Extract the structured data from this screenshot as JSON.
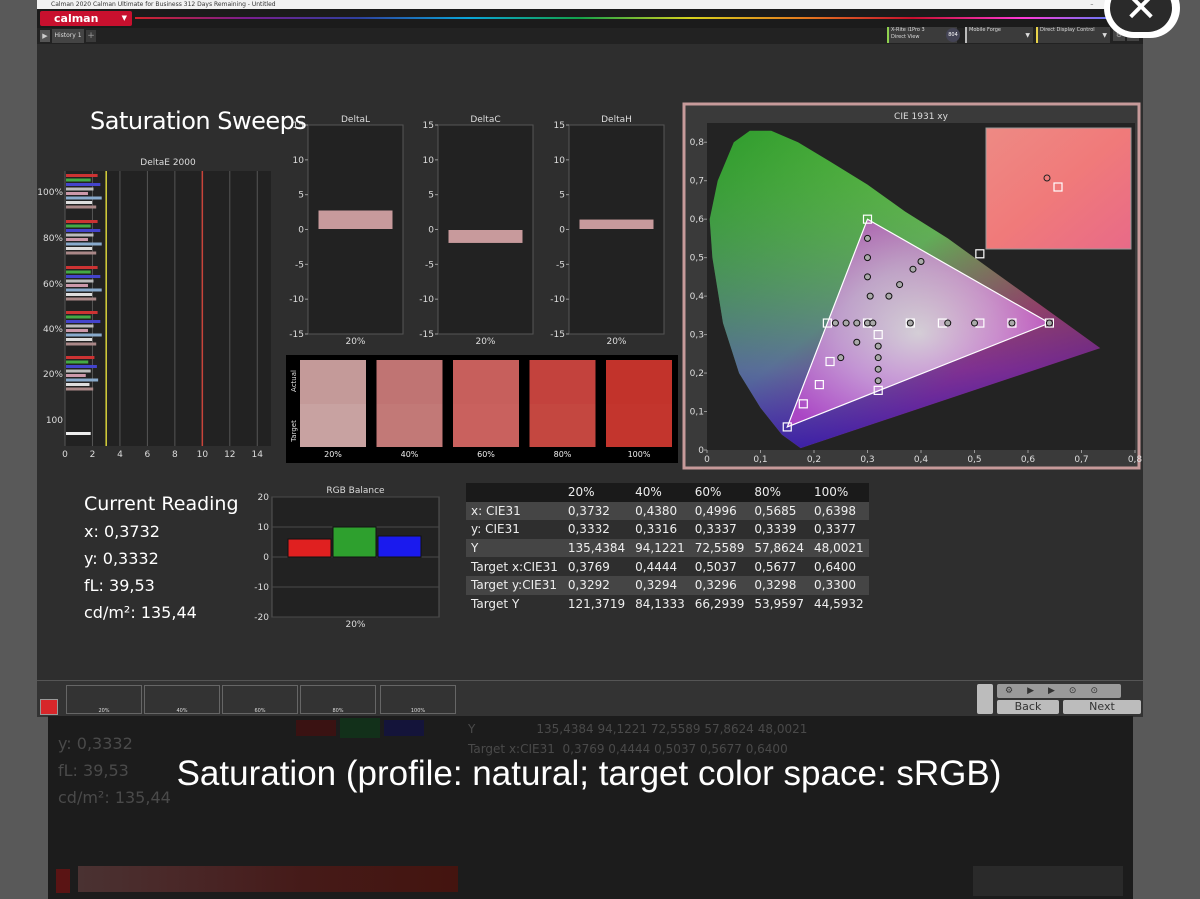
{
  "window": {
    "title": "Calman 2020 Calman Ultimate for Business 312 Days Remaining - Untitled",
    "logo": "calman",
    "history_tab": "History 1",
    "devices": [
      {
        "line1": "X-Rite i1Pro 3",
        "line2": "Direct View"
      },
      {
        "line1": "Mobile Forge",
        "line2": ""
      },
      {
        "line1": "Direct Display Control",
        "line2": ""
      }
    ],
    "badge": "804"
  },
  "page": {
    "title": "Saturation Sweeps",
    "caption": "Saturation (profile: natural; target color space: sRGB)"
  },
  "current_reading": {
    "heading": "Current Reading",
    "x": "x: 0,3732",
    "y": "y: 0,3332",
    "fl": "fL: 39,53",
    "cdm2": "cd/m²: 135,44"
  },
  "chart_data": [
    {
      "type": "bar",
      "title": "DeltaE 2000",
      "orientation": "horizontal",
      "categories": [
        "100%",
        "80%",
        "60%",
        "40%",
        "20%",
        "100"
      ],
      "xticks": [
        "0",
        "2",
        "4",
        "6",
        "8",
        "10",
        "12",
        "14"
      ],
      "xlim": [
        0,
        15
      ],
      "reference_lines": [
        3,
        10
      ]
    },
    {
      "type": "bar",
      "title": "DeltaL",
      "categories": [
        "20%"
      ],
      "values": [
        2.8
      ],
      "ylim": [
        -15,
        15
      ],
      "yticks": [
        "15",
        "10",
        "5",
        "0",
        "-5",
        "-10",
        "-15"
      ]
    },
    {
      "type": "bar",
      "title": "DeltaC",
      "categories": [
        "20%"
      ],
      "values": [
        -2.0
      ],
      "ylim": [
        -15,
        15
      ],
      "yticks": [
        "15",
        "10",
        "5",
        "0",
        "-5",
        "-10",
        "-15"
      ]
    },
    {
      "type": "bar",
      "title": "DeltaH",
      "categories": [
        "20%"
      ],
      "values": [
        1.5
      ],
      "ylim": [
        -15,
        15
      ],
      "yticks": [
        "15",
        "10",
        "5",
        "0",
        "-5",
        "-10",
        "-15"
      ]
    },
    {
      "type": "bar",
      "title": "RGB Balance",
      "categories": [
        "20%"
      ],
      "series": [
        {
          "color": "#e02020",
          "values": [
            6
          ]
        },
        {
          "color": "#2ea02e",
          "values": [
            10
          ]
        },
        {
          "color": "#1a1aee",
          "values": [
            7
          ]
        }
      ],
      "ylim": [
        -20,
        20
      ],
      "yticks": [
        "20",
        "10",
        "0",
        "-10",
        "-20"
      ]
    },
    {
      "type": "scatter",
      "title": "CIE 1931 xy",
      "xlim": [
        0,
        0.8
      ],
      "ylim": [
        0,
        0.85
      ],
      "xticks": [
        "0",
        "0,1",
        "0,2",
        "0,3",
        "0,4",
        "0,5",
        "0,6",
        "0,7",
        "0,8"
      ],
      "yticks": [
        "0",
        "0,1",
        "0,2",
        "0,3",
        "0,4",
        "0,5",
        "0,6",
        "0,7",
        "0,8"
      ],
      "gamut": [
        [
          0.64,
          0.33
        ],
        [
          0.3,
          0.6
        ],
        [
          0.15,
          0.06
        ]
      ],
      "targets": [
        [
          0.3,
          0.6
        ],
        [
          0.3,
          0.33
        ],
        [
          0.23,
          0.23
        ],
        [
          0.21,
          0.17
        ],
        [
          0.18,
          0.12
        ],
        [
          0.15,
          0.06
        ],
        [
          0.32,
          0.155
        ],
        [
          0.32,
          0.3
        ],
        [
          0.64,
          0.33
        ],
        [
          0.57,
          0.33
        ],
        [
          0.51,
          0.33
        ],
        [
          0.44,
          0.33
        ],
        [
          0.38,
          0.33
        ],
        [
          0.51,
          0.51
        ],
        [
          0.225,
          0.33
        ]
      ],
      "measured": [
        [
          0.3,
          0.55
        ],
        [
          0.3,
          0.5
        ],
        [
          0.3,
          0.45
        ],
        [
          0.305,
          0.4
        ],
        [
          0.3,
          0.33
        ],
        [
          0.24,
          0.33
        ],
        [
          0.26,
          0.33
        ],
        [
          0.28,
          0.33
        ],
        [
          0.31,
          0.33
        ],
        [
          0.38,
          0.33
        ],
        [
          0.45,
          0.33
        ],
        [
          0.5,
          0.33
        ],
        [
          0.57,
          0.33
        ],
        [
          0.64,
          0.33
        ],
        [
          0.34,
          0.4
        ],
        [
          0.36,
          0.43
        ],
        [
          0.385,
          0.47
        ],
        [
          0.4,
          0.49
        ],
        [
          0.32,
          0.27
        ],
        [
          0.32,
          0.24
        ],
        [
          0.32,
          0.21
        ],
        [
          0.32,
          0.18
        ],
        [
          0.28,
          0.28
        ],
        [
          0.25,
          0.24
        ]
      ]
    }
  ],
  "swatches": {
    "labels": [
      "20%",
      "40%",
      "60%",
      "80%",
      "100%"
    ],
    "actual_label": "Actual",
    "target_label": "Target",
    "actual_colors": [
      "#c49a99",
      "#c07473",
      "#c75f5c",
      "#c3423d",
      "#c2332b"
    ],
    "target_colors": [
      "#c8a2a1",
      "#c27977",
      "#c9615e",
      "#c44740",
      "#c3352d"
    ]
  },
  "table": {
    "headers": [
      "",
      "20%",
      "40%",
      "60%",
      "80%",
      "100%"
    ],
    "rows": [
      [
        "x: CIE31",
        "0,3732",
        "0,4380",
        "0,4996",
        "0,5685",
        "0,6398"
      ],
      [
        "y: CIE31",
        "0,3332",
        "0,3316",
        "0,3337",
        "0,3339",
        "0,3377"
      ],
      [
        "Y",
        "135,4384",
        "94,1221",
        "72,5589",
        "57,8624",
        "48,0021"
      ],
      [
        "Target x:CIE31",
        "0,3769",
        "0,4444",
        "0,5037",
        "0,5677",
        "0,6400"
      ],
      [
        "Target y:CIE31",
        "0,3292",
        "0,3294",
        "0,3296",
        "0,3298",
        "0,3300"
      ],
      [
        "Target Y",
        "121,3719",
        "84,1333",
        "66,2939",
        "53,9597",
        "44,5932"
      ]
    ]
  },
  "bottom": {
    "swatch_labels": [
      "20%",
      "40%",
      "60%",
      "80%",
      "100%"
    ],
    "swatch_colors": [
      "#c49a99",
      "#c07473",
      "#c75f5c",
      "#c3423d",
      "#c2332b"
    ],
    "back": "Back",
    "next": "Next"
  },
  "ghost": {
    "y": "y: 0,3332",
    "fl": "fL: 39,53",
    "cdm2": "cd/m²: 135,44",
    "row_y": "Y",
    "row_y_values": "135,4384   94,1221   72,5589   57,8624   48,0021",
    "row_tx": "Target x:CIE31",
    "row_tx_values": "0,3769   0,4444   0,5037   0,5677   0,6400"
  },
  "colors": {
    "accent": "#c8102e",
    "panel": "#2e2e2e",
    "cie_border": "#c79a9a"
  }
}
